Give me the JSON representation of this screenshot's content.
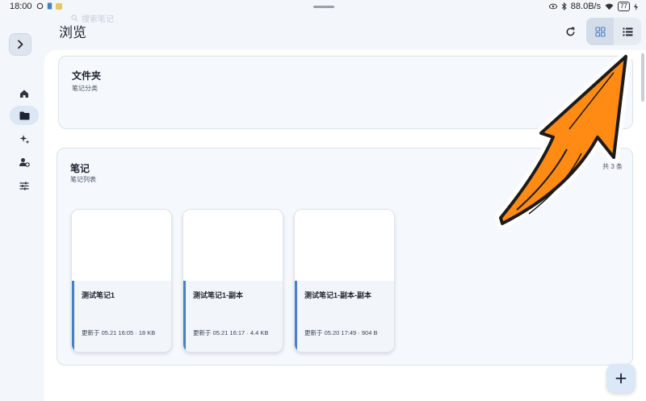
{
  "status_bar": {
    "time": "18:00",
    "net_speed": "88.0B/s",
    "battery": "77"
  },
  "header": {
    "title": "浏览",
    "search_placeholder": "搜索笔记"
  },
  "folders": {
    "title": "文件夹",
    "subtitle": "笔记分类"
  },
  "notes": {
    "title": "笔记",
    "subtitle": "笔记列表",
    "count": "共 3 条",
    "items": [
      {
        "title": "测试笔记1",
        "meta": "更新于 05.21 16:05 · 18 KB"
      },
      {
        "title": "测试笔记1-副本",
        "meta": "更新于 05.21 16:17 · 4.4 KB"
      },
      {
        "title": "测试笔记1-副本-副本",
        "meta": "更新于 05.20 17:49 · 904 B"
      }
    ]
  },
  "rail": {
    "items": [
      "home-icon",
      "folder-icon",
      "sparkle-icon",
      "person-settings-icon",
      "tune-icon"
    ],
    "active": "folder-icon"
  },
  "colors": {
    "accent": "#4a7fc1",
    "annotation_arrow": "#ff8a14"
  }
}
